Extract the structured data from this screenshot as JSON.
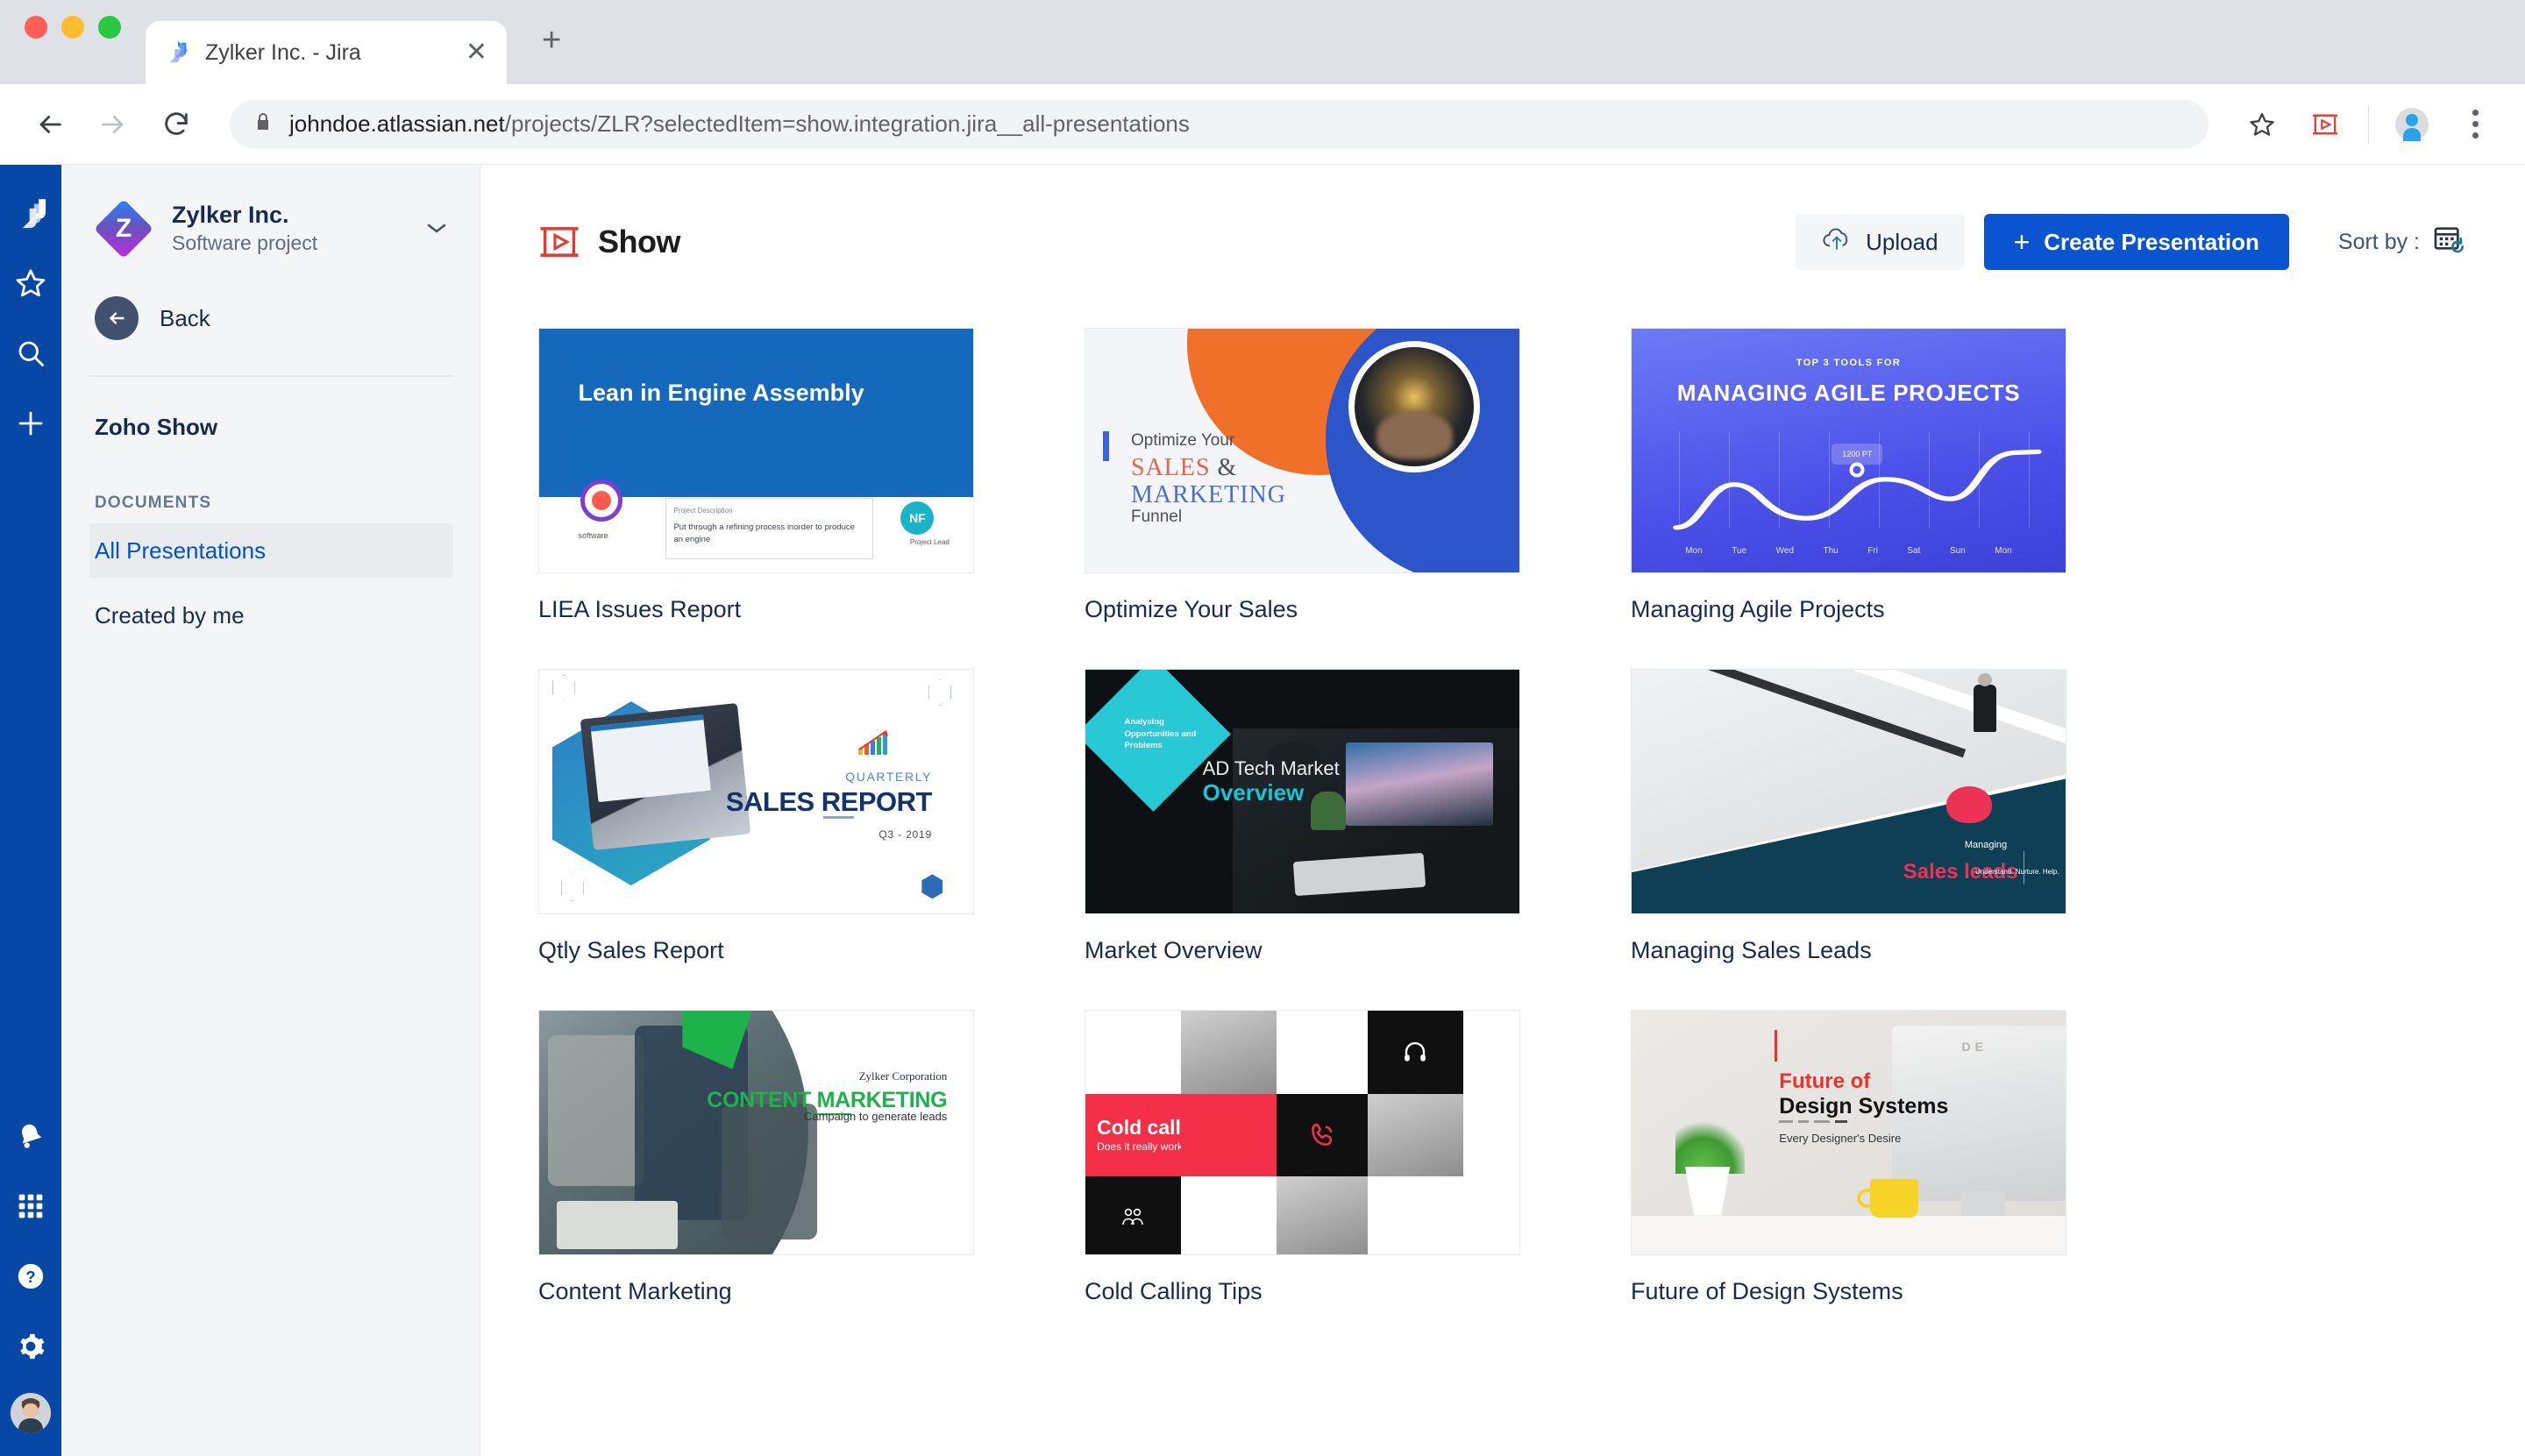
{
  "browser": {
    "tab": {
      "title": "Zylker Inc. - Jira",
      "favicon": "jira-icon",
      "close": "✕"
    },
    "new_tab": "+",
    "url_secure_part": "johndoe.atlassian.net",
    "url_path_part": "/projects/ZLR?selectedItem=show.integration.jira__all-presentations",
    "toolbar_icons": {
      "back": "back-arrow-icon",
      "forward": "forward-arrow-icon",
      "reload": "reload-icon",
      "lock": "lock-icon",
      "bookmark": "star-icon",
      "extension": "zoho-show-extension-icon",
      "profile": "profile-avatar-icon",
      "menu": "kebab-menu-icon"
    }
  },
  "rail": {
    "items": [
      {
        "name": "jira-logo",
        "label": "Jira"
      },
      {
        "name": "starred",
        "label": "Starred"
      },
      {
        "name": "search",
        "label": "Search"
      },
      {
        "name": "create",
        "label": "Create"
      }
    ],
    "bottom": [
      {
        "name": "notifications",
        "label": "Notifications"
      },
      {
        "name": "app-switcher",
        "label": "App switcher"
      },
      {
        "name": "help",
        "label": "Help"
      },
      {
        "name": "settings",
        "label": "Settings"
      },
      {
        "name": "avatar",
        "label": "Your profile"
      }
    ]
  },
  "sidebar": {
    "project": {
      "initial": "Z",
      "name": "Zylker Inc.",
      "type": "Software project",
      "chevron": "⌄"
    },
    "back_label": "Back",
    "app_title": "Zoho Show",
    "section_label": "DOCUMENTS",
    "items": [
      {
        "label": "All Presentations",
        "active": true
      },
      {
        "label": "Created by me",
        "active": false
      }
    ]
  },
  "main": {
    "brand_title": "Show",
    "upload_label": "Upload",
    "create_label": "Create Presentation",
    "create_plus": "+",
    "sort_label": "Sort by :",
    "sort_icon": "calendar-recent-icon",
    "cards": [
      {
        "title": "LIEA Issues Report",
        "slide": {
          "heading": "Lean in Engine Assembly",
          "icon_label": "software",
          "desc_heading": "Project Description",
          "desc_body": "Put through a refining process inorder to produce an engine",
          "avatar_initials": "NF",
          "avatar_label": "Project Lead"
        }
      },
      {
        "title": "Optimize Your Sales",
        "slide": {
          "line1": "Optimize Your",
          "line2": "SALES",
          "line2_amp": "&",
          "line3": "MARKETING",
          "line4": "Funnel"
        }
      },
      {
        "title": "Managing Agile Projects",
        "slide": {
          "eyebrow": "TOP 3 TOOLS FOR",
          "heading": "MANAGING AGILE PROJECTS",
          "tooltip": "1200 PT",
          "days": [
            "Mon",
            "Tue",
            "Wed",
            "Thu",
            "Fri",
            "Sat",
            "Sun",
            "Mon"
          ]
        }
      },
      {
        "title": "Qtly Sales Report",
        "slide": {
          "eyebrow": "QUARTERLY",
          "heading": "SALES REPORT",
          "subtitle": "Q3 - 2019"
        }
      },
      {
        "title": "Market Overview",
        "slide": {
          "diamond_text": "Analysing Opportunities and Problems",
          "line1": "AD Tech Market",
          "line2": "Overview"
        }
      },
      {
        "title": "Managing Sales Leads",
        "slide": {
          "line1": "Managing",
          "line2": "Sales leads",
          "tagline": "Understand. Nurture. Help."
        }
      },
      {
        "title": "Content Marketing",
        "slide": {
          "corp": "Zylker Corporation",
          "heading_green": "CONTENT",
          "heading_dark": "MARKETING",
          "subtitle": "Campaign to generate leads"
        }
      },
      {
        "title": "Cold Calling Tips",
        "slide": {
          "heading": "Cold calling tips",
          "subtitle": "Does it really work ?",
          "icons": [
            "headphones-icon",
            "phone-call-icon",
            "people-icon"
          ]
        }
      },
      {
        "title": "Future of Design Systems",
        "slide": {
          "line1": "Future of",
          "line2": "Design Systems",
          "subtitle": "Every Designer's Desire",
          "watermark": "DE"
        }
      }
    ]
  },
  "colors": {
    "jira_blue": "#0747a6",
    "accent_blue": "#0b54d1",
    "link_blue": "#0052cc",
    "show_red": "#e8392f",
    "sidebar_bg": "#f4f5f7"
  }
}
